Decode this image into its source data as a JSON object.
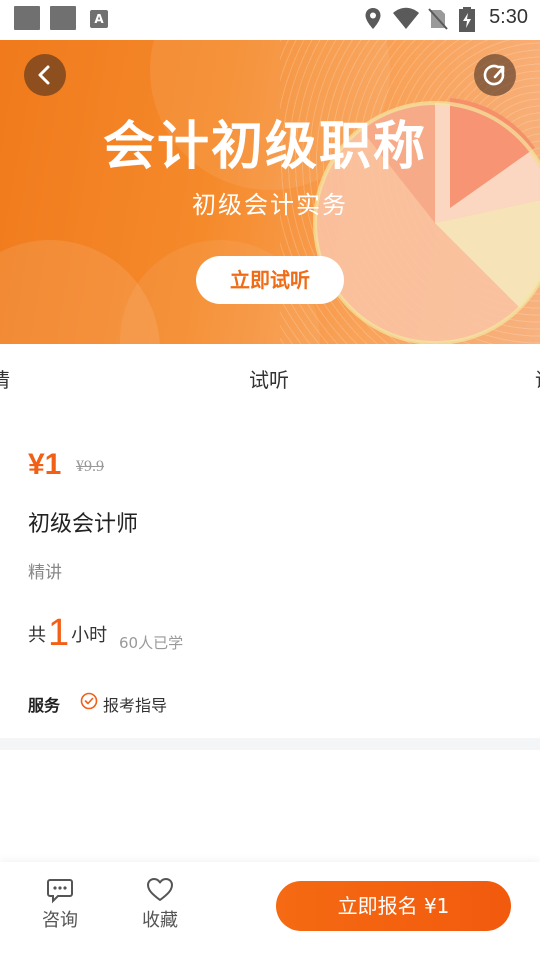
{
  "status_bar": {
    "time": "5:30",
    "app_badge": "A"
  },
  "banner": {
    "title": "会计初级职称",
    "subtitle": "初级会计实务",
    "cta_label": "立即试听"
  },
  "tabs": {
    "left_partial": "情",
    "center": "试听",
    "right_partial": "课"
  },
  "course": {
    "price": "¥1",
    "original_price": "¥9.9",
    "title": "初级会计师",
    "subtitle": "精讲",
    "hours_prefix": "共",
    "hours_value": "1",
    "hours_suffix": "小时",
    "learned": "60人已学",
    "service_label": "服务",
    "service_item": "报考指导"
  },
  "bottom_bar": {
    "consult_label": "咨询",
    "favorite_label": "收藏",
    "enroll_label": "立即报名 ¥1"
  },
  "colors": {
    "accent": "#f25f17",
    "banner": "#f07a1c"
  }
}
